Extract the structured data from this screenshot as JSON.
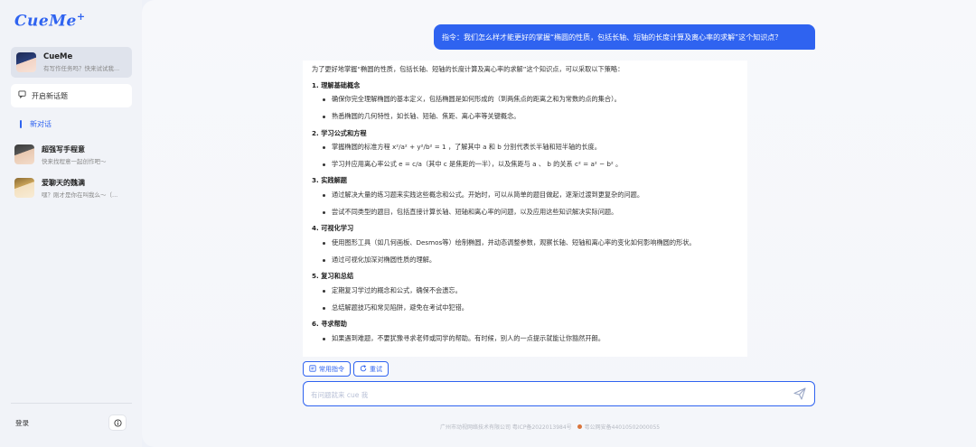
{
  "app": {
    "logo": "CueMe",
    "logo_mark": "+"
  },
  "sidebar": {
    "current_agent": {
      "name": "CueMe",
      "subtitle": "有写作任务吗？快来试试我..."
    },
    "new_topic_label": "开启新话题",
    "section_label": "新对话",
    "agents": [
      {
        "name": "超强写手程意",
        "subtitle": "快来找程意一起创作吧～"
      },
      {
        "name": "爱聊天的魏满",
        "subtitle": "嘿？刚才是你在叫我么～（..."
      }
    ],
    "login_label": "登录",
    "info_icon": "info-icon"
  },
  "chat": {
    "user_message": "指令：我们怎么样才能更好的掌握“椭圆的性质，包括长轴、短轴的长度计算及离心率的求解”这个知识点？",
    "answer": {
      "intro": "为了更好地掌握“椭圆的性质，包括长轴、短轴的长度计算及离心率的求解”这个知识点，可以采取以下策略：",
      "sections": [
        {
          "title": "1. 理解基础概念",
          "items": [
            "确保你完全理解椭圆的基本定义，包括椭圆是如何形成的（到两焦点的距离之和为常数的点的集合）。",
            "熟悉椭圆的几何特性，如长轴、短轴、焦距、离心率等关键概念。"
          ]
        },
        {
          "title": "2. 学习公式和方程",
          "items": [
            "掌握椭圆的标准方程 x²/a² + y²/b² = 1 ，了解其中 a 和 b 分别代表长半轴和短半轴的长度。",
            "学习并应用离心率公式 e = c/a（其中 c 是焦距的一半），以及焦距与 a 、 b 的关系 c² = a² − b² 。"
          ]
        },
        {
          "title": "3. 实践解题",
          "items": [
            "通过解决大量的练习题来实践这些概念和公式。开始时，可以从简单的题目做起，逐渐过渡到更复杂的问题。",
            "尝试不同类型的题目，包括直接计算长轴、短轴和离心率的问题，以及应用这些知识解决实际问题。"
          ]
        },
        {
          "title": "4. 可视化学习",
          "items": [
            "使用图形工具（如几何画板、Desmos等）绘制椭圆，并动态调整参数，观察长轴、短轴和离心率的变化如何影响椭圆的形状。",
            "通过可视化加深对椭圆性质的理解。"
          ]
        },
        {
          "title": "5. 复习和总结",
          "items": [
            "定期复习学过的概念和公式，确保不会遗忘。",
            "总结解题技巧和常见陷阱，避免在考试中犯错。"
          ]
        },
        {
          "title": "6. 寻求帮助",
          "items": [
            "如果遇到难题，不要犹豫寻求老师或同学的帮助。有时候，别人的一点提示就能让你豁然开朗。"
          ]
        }
      ]
    },
    "actions": {
      "common_commands": "常用指令",
      "retry": "重试"
    },
    "input": {
      "placeholder": "有问题就来 cue 我",
      "value": ""
    }
  },
  "footer": {
    "icp": "广州市动视网络技术有限公司 粤ICP备2022013984号",
    "police": "粤公网安备44010502000055"
  },
  "colors": {
    "accent": "#2f63f0",
    "sidebar_bg": "#f1f3f8",
    "main_bg": "#f6f7fa"
  }
}
